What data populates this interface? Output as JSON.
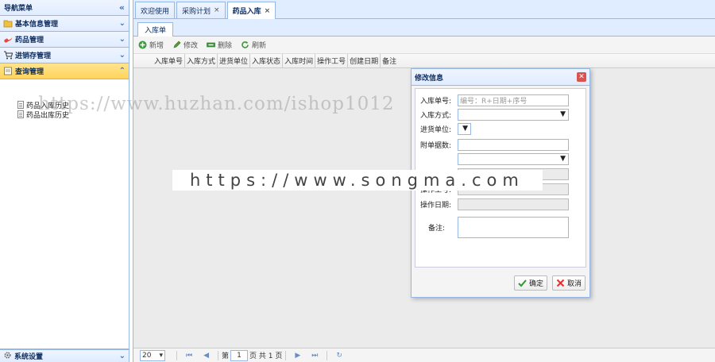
{
  "nav": {
    "title": "导航菜单",
    "collapse_glyph": "«",
    "sections": [
      {
        "label": "基本信息管理",
        "icon": "folder-icon"
      },
      {
        "label": "药品管理",
        "icon": "pill-icon"
      },
      {
        "label": "进销存管理",
        "icon": "cart-icon"
      },
      {
        "label": "查询管理",
        "icon": "query-icon",
        "active": true
      }
    ],
    "tree_items": [
      "药品入库历史",
      "药品出库历史"
    ],
    "bottom_section": {
      "label": "系统设置",
      "icon": "gear-icon"
    }
  },
  "tabs": [
    {
      "label": "欢迎使用",
      "closable": false
    },
    {
      "label": "采购计划",
      "closable": true
    },
    {
      "label": "药品入库",
      "closable": true,
      "active": true
    }
  ],
  "panel": {
    "sub_tab": "入库单",
    "toolbar": {
      "add": "新增",
      "edit": "修改",
      "delete": "删除",
      "refresh": "刷新"
    },
    "columns": [
      "入库单号",
      "入库方式",
      "进货单位",
      "入库状态",
      "入库时间",
      "操作工号",
      "创建日期",
      "备注"
    ],
    "pager": {
      "page_size": "20",
      "page_prefix": "第",
      "page_value": "1",
      "page_suffix": "页 共 1 页"
    }
  },
  "dialog": {
    "title": "修改信息",
    "fields": {
      "order_no": {
        "label": "入库单号:",
        "placeholder": "编号：R+日期+序号"
      },
      "method": {
        "label": "入库方式:"
      },
      "supplier": {
        "label": "进货单位:"
      },
      "attach_count": {
        "label": "附单据数:"
      },
      "operator_no": {
        "label": "操作工号:"
      },
      "operate_date": {
        "label": "操作日期:"
      },
      "remark": {
        "label": "备注:"
      }
    },
    "confirm": "确定",
    "cancel": "取消"
  },
  "watermarks": {
    "top": "https://www.huzhan.com/ishop1012",
    "middle": "https://www.songma.com"
  },
  "colors": {
    "border": "#95b8e7",
    "header_bg": "#e0ecff",
    "active_section": "#ffd45b"
  }
}
